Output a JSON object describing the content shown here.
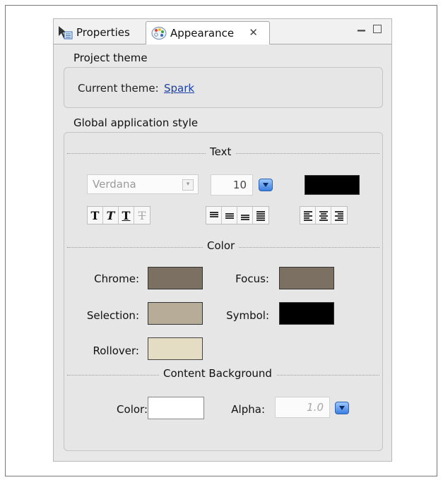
{
  "tabs": [
    {
      "label": "Properties",
      "icon": "properties-icon",
      "active": false
    },
    {
      "label": "Appearance",
      "icon": "palette-icon",
      "active": true
    }
  ],
  "project_theme": {
    "title": "Project theme",
    "current_label": "Current theme:",
    "current_value": "Spark"
  },
  "global_style": {
    "title": "Global application style",
    "text_section": "Text",
    "font_family": "Verdana",
    "font_size": "10",
    "text_color": "#000000",
    "color_section": "Color",
    "colors": {
      "chrome": {
        "label": "Chrome:",
        "value": "#7b7062"
      },
      "focus": {
        "label": "Focus:",
        "value": "#7b7062"
      },
      "selection": {
        "label": "Selection:",
        "value": "#b6ac98"
      },
      "symbol": {
        "label": "Symbol:",
        "value": "#000000"
      },
      "rollover": {
        "label": "Rollover:",
        "value": "#e4ddc4"
      }
    },
    "content_bg_section": "Content Background",
    "content_bg": {
      "color_label": "Color:",
      "color_value": "#ffffff",
      "alpha_label": "Alpha:",
      "alpha_value": "1.0"
    }
  }
}
